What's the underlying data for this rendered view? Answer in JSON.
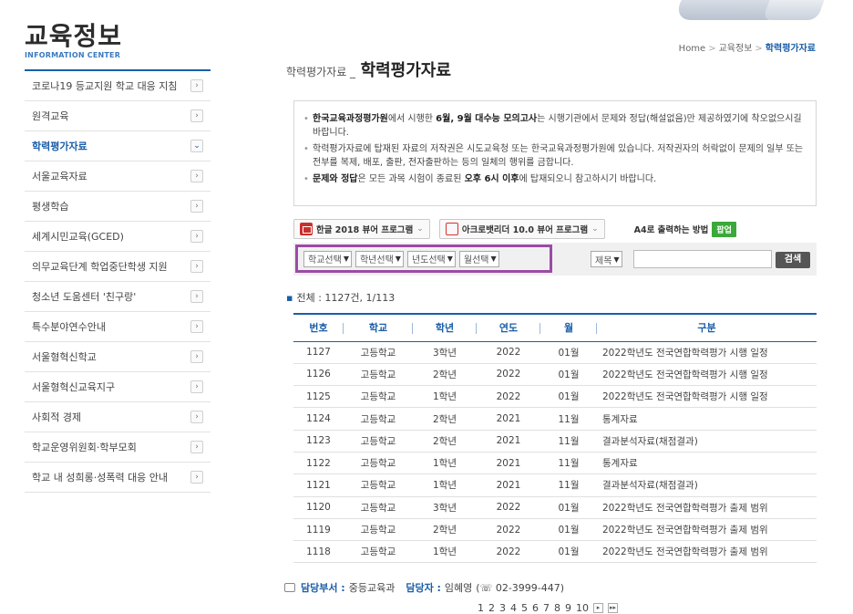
{
  "logo": {
    "title": "교육정보",
    "subtitle": "INFORMATION CENTER"
  },
  "sidebar": {
    "items": [
      {
        "label": "코로나19 등교지원 학교 대응 지침",
        "icon": "chevron-right",
        "active": false
      },
      {
        "label": "원격교육",
        "icon": "chevron-right",
        "active": false
      },
      {
        "label": "학력평가자료",
        "icon": "chevron-down",
        "active": true
      },
      {
        "label": "서울교육자료",
        "icon": "chevron-right",
        "active": false
      },
      {
        "label": "평생학습",
        "icon": "chevron-right",
        "active": false
      },
      {
        "label": "세계시민교육(GCED)",
        "icon": "chevron-right",
        "active": false
      },
      {
        "label": "의무교육단계 학업중단학생 지원",
        "icon": "chevron-right",
        "active": false
      },
      {
        "label": "청소년 도움센터 '친구랑'",
        "icon": "chevron-right",
        "active": false
      },
      {
        "label": "특수분야연수안내",
        "icon": "chevron-right",
        "active": false
      },
      {
        "label": "서울형혁신학교",
        "icon": "chevron-right",
        "active": false
      },
      {
        "label": "서울형혁신교육지구",
        "icon": "chevron-right",
        "active": false
      },
      {
        "label": "사회적 경제",
        "icon": "chevron-right",
        "active": false
      },
      {
        "label": "학교운영위원회·학부모회",
        "icon": "chevron-right",
        "active": false
      },
      {
        "label": "학교 내 성희롱·성폭력 대응 안내",
        "icon": "chevron-right",
        "active": false
      }
    ]
  },
  "breadcrumb": {
    "home": "Home",
    "level1": "교육정보",
    "current": "학력평가자료"
  },
  "page_title": {
    "small": "학력평가자료 _",
    "big": "학력평가자료"
  },
  "notice": {
    "p1_b1": "한국교육과정평가원",
    "p1_t1": "에서 시행한 ",
    "p1_b2": "6월, 9월 대수능 모의고사",
    "p1_t2": "는 시행기관에서 문제와 정답(해설없음)만 제공하였기에 착오없으시길 바랍니다.",
    "p2": "학력평가자료에 탑재된 자료의 저작권은 시도교육청 또는 한국교육과정평가원에 있습니다. 저작권자의 허락없이 문제의 일부 또는 전부를 복제, 배포, 출판, 전자출판하는 등의 일체의 행위를 금합니다.",
    "p3_b1": "문제와 정답",
    "p3_t1": "은 모든 과목 시험이 종료된 ",
    "p3_b2": "오후 6시 이후",
    "p3_t2": "에 탑재되오니 참고하시기 바랍니다."
  },
  "toolbar": {
    "hwp_viewer": "한글 2018 뷰어 프로그램",
    "pdf_viewer": "아크로뱃리더 10.0 뷰어 프로그램",
    "print_help": "A4로 출력하는 방법",
    "popup": "팝업"
  },
  "filters": {
    "school": "학교선택",
    "grade": "학년선택",
    "year": "년도선택",
    "month": "월선택",
    "search_field": "제목",
    "search_value": "",
    "search_button": "검색"
  },
  "total": {
    "label": "전체 : 1127건, 1/113"
  },
  "table": {
    "headers": [
      "번호",
      "학교",
      "학년",
      "연도",
      "월",
      "구분"
    ],
    "rows": [
      [
        "1127",
        "고등학교",
        "3학년",
        "2022",
        "01월",
        "2022학년도 전국연합학력평가 시행 일정"
      ],
      [
        "1126",
        "고등학교",
        "2학년",
        "2022",
        "01월",
        "2022학년도 전국연합학력평가 시행 일정"
      ],
      [
        "1125",
        "고등학교",
        "1학년",
        "2022",
        "01월",
        "2022학년도 전국연합학력평가 시행 일정"
      ],
      [
        "1124",
        "고등학교",
        "2학년",
        "2021",
        "11월",
        "통계자료"
      ],
      [
        "1123",
        "고등학교",
        "2학년",
        "2021",
        "11월",
        "결과분석자료(채점결과)"
      ],
      [
        "1122",
        "고등학교",
        "1학년",
        "2021",
        "11월",
        "통계자료"
      ],
      [
        "1121",
        "고등학교",
        "1학년",
        "2021",
        "11월",
        "결과분석자료(채점결과)"
      ],
      [
        "1120",
        "고등학교",
        "3학년",
        "2022",
        "01월",
        "2022학년도 전국연합학력평가 출제 범위"
      ],
      [
        "1119",
        "고등학교",
        "2학년",
        "2022",
        "01월",
        "2022학년도 전국연합학력평가 출제 범위"
      ],
      [
        "1118",
        "고등학교",
        "1학년",
        "2022",
        "01월",
        "2022학년도 전국연합학력평가 출제 범위"
      ]
    ]
  },
  "contact": {
    "dept_label": "담당부서 :",
    "dept": "중등교육과",
    "person_label": "담당자 :",
    "person": "임혜영",
    "phone": "(☏ 02-3999-447)"
  },
  "pager": {
    "pages": [
      "1",
      "2",
      "3",
      "4",
      "5",
      "6",
      "7",
      "8",
      "9",
      "10"
    ],
    "next": "▸",
    "last": "▸▸"
  },
  "colors": {
    "accent": "#1a5ea8",
    "highlight_border": "#9b4ba5",
    "popup": "#3aa83a"
  }
}
